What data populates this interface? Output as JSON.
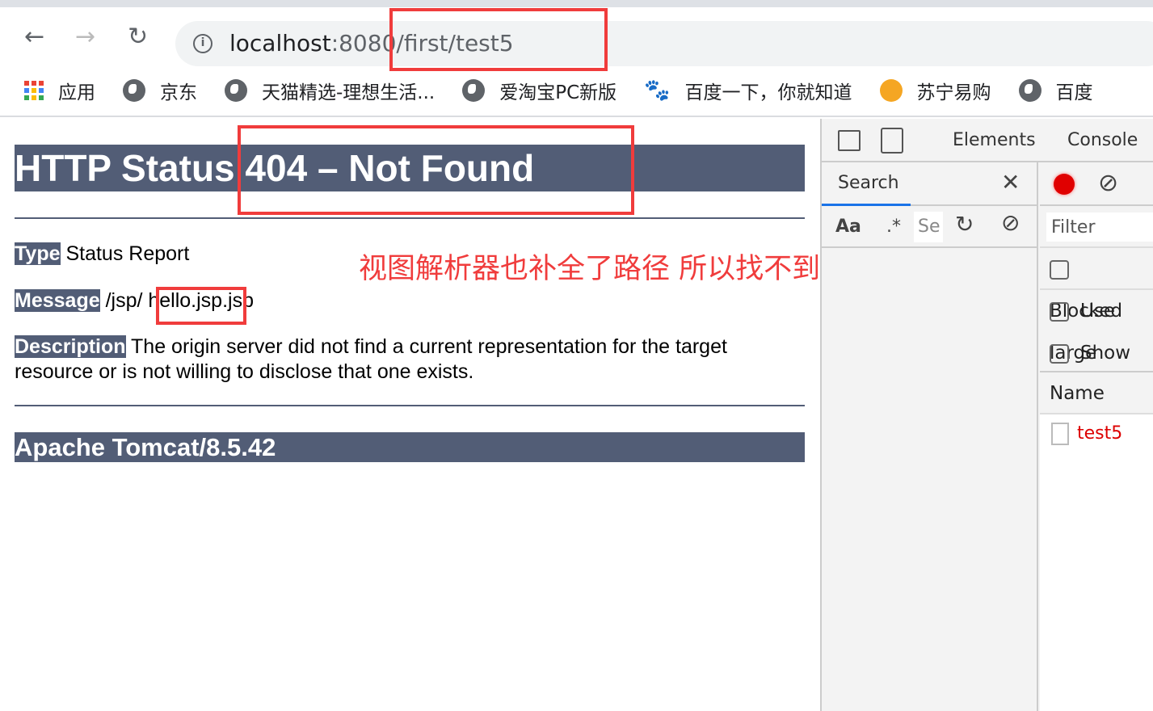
{
  "browser": {
    "url_host": "localhost",
    "url_rest": ":8080/first/test5",
    "bookmarks": [
      "应用",
      "京东",
      "天猫精选-理想生活...",
      "爱淘宝PC新版",
      "百度一下，你就知道",
      "苏宁易购",
      "百度"
    ]
  },
  "page": {
    "title": "HTTP Status 404 – Not Found",
    "type_label": "Type",
    "type_value": " Status Report",
    "message_label": "Message",
    "message_value": " /jsp/ hello.jsp.jsp",
    "description_label": "Description",
    "description_value": " The origin server did not find a current representation for the target resource or is not willing to disclose that one exists.",
    "footer": "Apache Tomcat/8.5.42"
  },
  "annotation": "视图解析器也补全了路径  所以找不到",
  "devtools": {
    "tabs": [
      "Elements",
      "Console"
    ],
    "search_tab": "Search",
    "aa": "Aa",
    "regex": ".*",
    "search_placeholder": "Se",
    "filter_placeholder": "Filter",
    "checkboxes": [
      "Blocked",
      "Use large",
      "Show ov"
    ],
    "name_header": "Name",
    "request": "test5",
    "record_color": "#e00000"
  }
}
